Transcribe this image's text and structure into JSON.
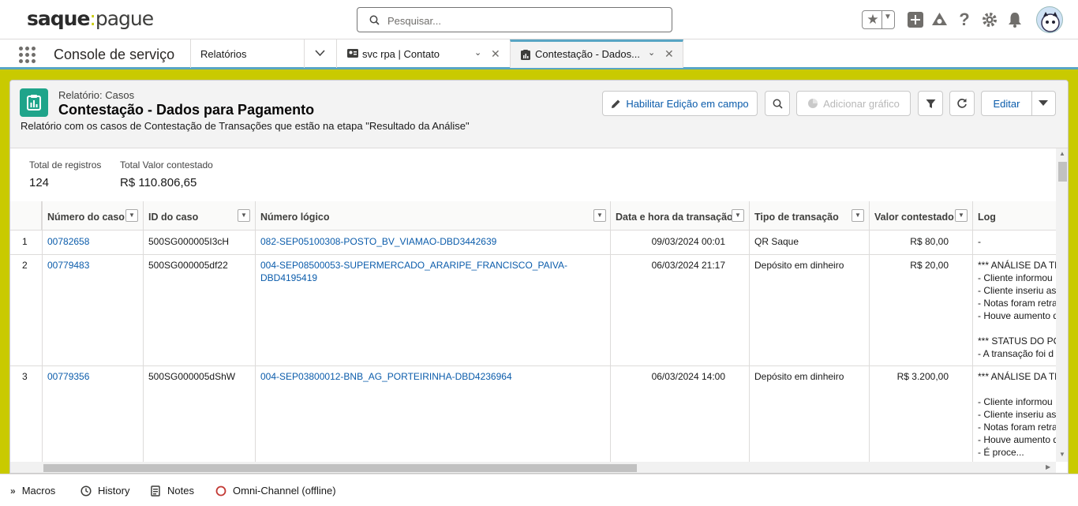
{
  "brand": {
    "logo_text_left": "saque",
    "logo_text_right": "pague"
  },
  "search": {
    "placeholder": "Pesquisar..."
  },
  "nav": {
    "app_name": "Console de serviço",
    "object_tab": "Relatórios",
    "tabs": [
      {
        "label": "svc rpa | Contato",
        "icon": "contact-card-icon"
      },
      {
        "label": "Contestação - Dados...",
        "icon": "report-icon",
        "active": true
      }
    ]
  },
  "report": {
    "breadcrumb": "Relatório: Casos",
    "title": "Contestação - Dados para Pagamento",
    "description": "Relatório com os casos de Contestação de Transações que estão na etapa \"Resultado da Análise\"",
    "buttons": {
      "inline_edit": "Habilitar Edição em campo",
      "add_chart": "Adicionar gráfico",
      "edit": "Editar"
    },
    "summary": {
      "total_records_label": "Total de registros",
      "total_records": "124",
      "total_value_label": "Total Valor contestado",
      "total_value": "R$ 110.806,65"
    },
    "columns": [
      "Número do caso",
      "ID do caso",
      "Número lógico",
      "Data e hora da transação",
      "Tipo de transação",
      "Valor contestado",
      "Log"
    ],
    "rows": [
      {
        "n": "1",
        "case_number": "00782658",
        "case_id": "500SG000005I3cH",
        "logical_number": "082-SEP05100308-POSTO_BV_VIAMAO-DBD3442639",
        "logical_number_2": "",
        "datetime": "09/03/2024 00:01",
        "type": "QR Saque",
        "value": "R$ 80,00",
        "log": [
          "-"
        ]
      },
      {
        "n": "2",
        "case_number": "00779483",
        "case_id": "500SG000005df22",
        "logical_number": "004-SEP08500053-SUPERMERCADO_ARARIPE_FRANCISCO_PAIVA-",
        "logical_number_2": "DBD4195419",
        "datetime": "06/03/2024 21:17",
        "type": "Depósito em dinheiro",
        "value": "R$ 20,00",
        "log": [
          "*** ANÁLISE DA TR",
          "- Cliente informou",
          "- Cliente inseriu as",
          "- Notas foram retra",
          "- Houve aumento d",
          "",
          "*** STATUS DO PO",
          "- A transação foi d"
        ]
      },
      {
        "n": "3",
        "case_number": "00779356",
        "case_id": "500SG000005dShW",
        "logical_number": "004-SEP03800012-BNB_AG_PORTEIRINHA-DBD4236964",
        "logical_number_2": "",
        "datetime": "06/03/2024 14:00",
        "type": "Depósito em dinheiro",
        "value": "R$ 3.200,00",
        "log": [
          "*** ANÁLISE DA TR",
          "",
          "- Cliente informou",
          "- Cliente inseriu as",
          "- Notas foram retra",
          "- Houve aumento d",
          "- É proce..."
        ]
      }
    ]
  },
  "utility_bar": {
    "macros": "Macros",
    "history": "History",
    "notes": "Notes",
    "omni": "Omni-Channel (offline)"
  },
  "colors": {
    "brand_bar": "#c9ca00",
    "accent": "#58a5c4",
    "link": "#0b5cab",
    "report_icon": "#1fa48a"
  }
}
